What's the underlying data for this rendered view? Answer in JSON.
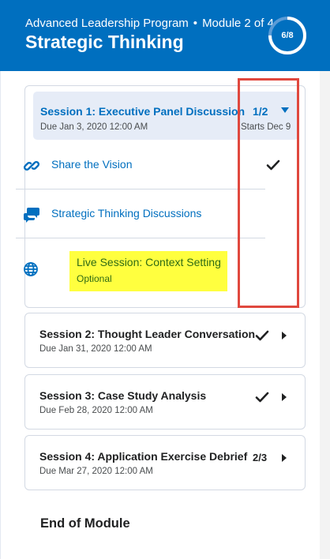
{
  "header": {
    "program": "Advanced Leadership Program",
    "separator": "•",
    "module": "Module 2 of 4",
    "title": "Strategic Thinking",
    "progress_label": "6/8",
    "progress_fraction": 0.75,
    "bg_color": "#006fbf"
  },
  "sessions": [
    {
      "title": "Session 1: Executive Panel Discussion",
      "due": "Due Jan 3, 2020 12:00 AM",
      "count": "1/2",
      "starts": "Starts Dec 9",
      "expanded": true,
      "items": [
        {
          "icon": "link-icon",
          "label": "Share the Vision",
          "completed": true
        },
        {
          "icon": "discussion-icon",
          "label": "Strategic Thinking Discussions",
          "completed": false
        },
        {
          "icon": "globe-icon",
          "label": "Live Session: Context Setting",
          "sublabel": "Optional",
          "completed": false
        }
      ]
    },
    {
      "title": "Session 2: Thought Leader Conversation",
      "due": "Due Jan 31, 2020 12:00 AM",
      "status": "completed",
      "expanded": false
    },
    {
      "title": "Session 3: Case Study Analysis",
      "due": "Due Feb 28, 2020 12:00 AM",
      "status": "completed",
      "expanded": false
    },
    {
      "title": "Session 4: Application Exercise Debrief",
      "due": "Due Mar 27, 2020 12:00 AM",
      "count": "2/3",
      "expanded": false
    }
  ],
  "end_label": "End of Module",
  "colors": {
    "accent": "#006fbf",
    "highlight": "#ffff3f",
    "annotation": "#e0483e"
  }
}
